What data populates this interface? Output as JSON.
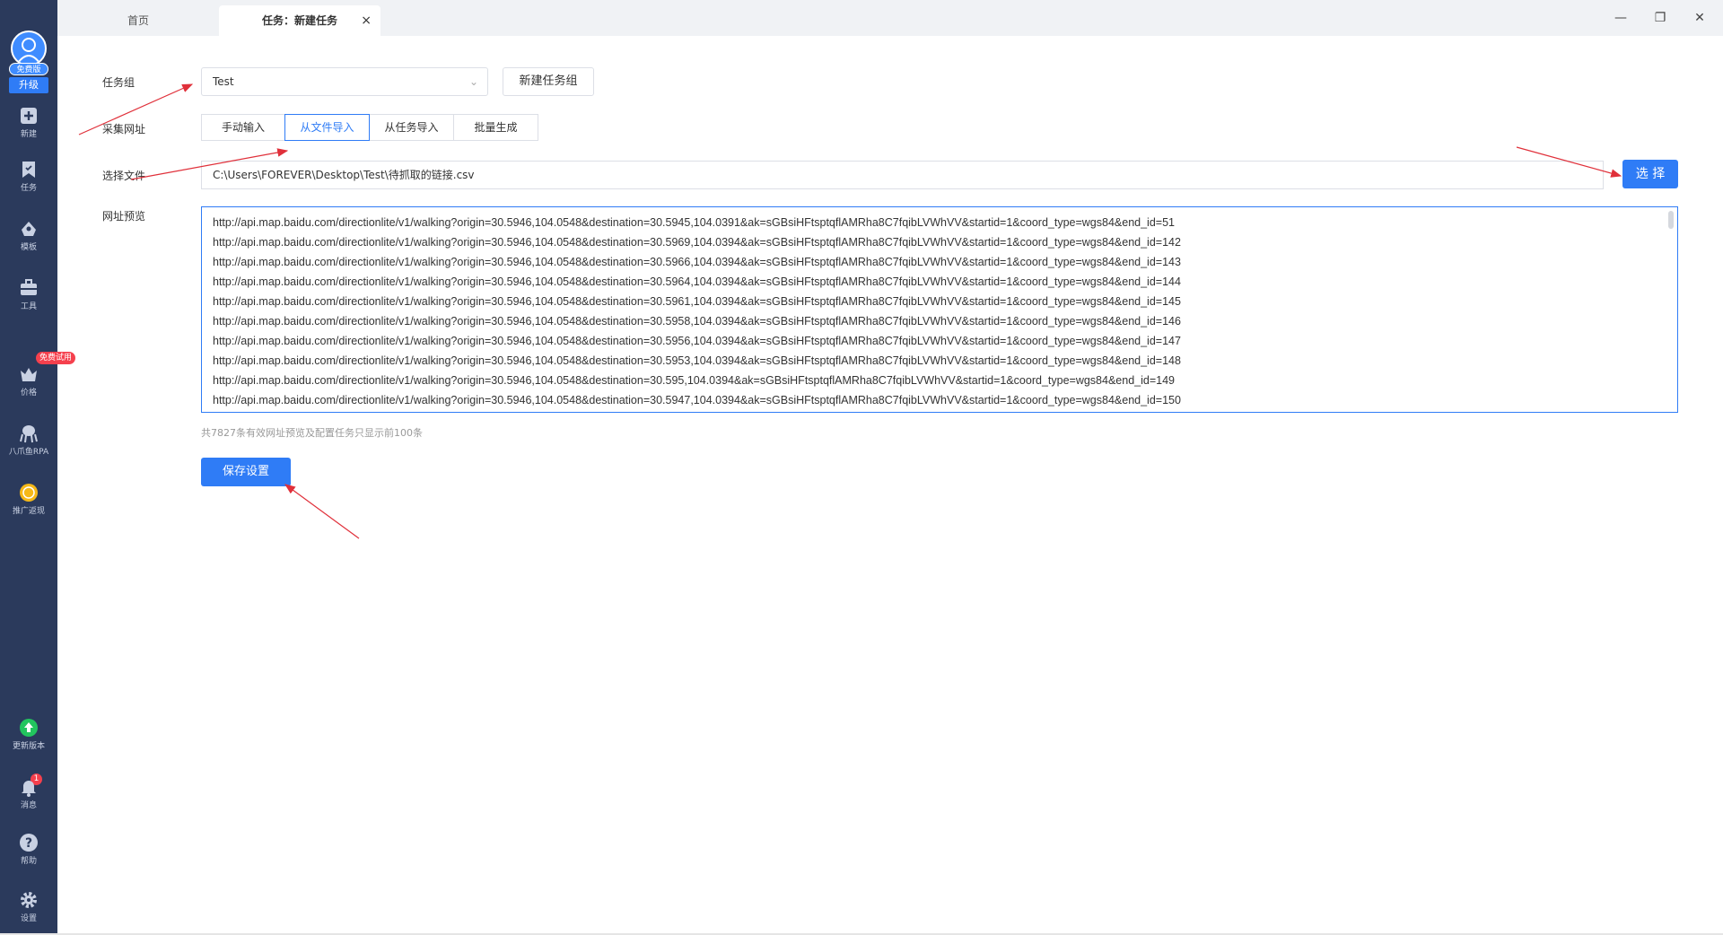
{
  "tabs": {
    "home": "首页",
    "active": "任务：新建任务",
    "close_glyph": "×"
  },
  "window": {
    "minimize": "—",
    "restore": "❐",
    "close": "✕"
  },
  "sidebar": {
    "free_badge": "免费版",
    "upgrade": "升级",
    "items": [
      {
        "label": "新建",
        "icon": "plus-square-icon"
      },
      {
        "label": "任务",
        "icon": "bookmark-icon"
      },
      {
        "label": "模板",
        "icon": "template-icon"
      },
      {
        "label": "工具",
        "icon": "toolbox-icon"
      },
      {
        "label": "价格",
        "icon": "crown-icon"
      },
      {
        "label": "八爪鱼RPA",
        "icon": "octopus-icon"
      },
      {
        "label": "推广返现",
        "icon": "coin-icon"
      },
      {
        "label": "更新版本",
        "icon": "upgrade-icon"
      },
      {
        "label": "消息",
        "icon": "bell-icon"
      },
      {
        "label": "帮助",
        "icon": "help-icon"
      },
      {
        "label": "设置",
        "icon": "gear-icon"
      }
    ],
    "trial_badge": "免费试用",
    "message_count": "1"
  },
  "form": {
    "task_group_label": "任务组",
    "task_group_value": "Test",
    "new_group_button": "新建任务组",
    "url_source_label": "采集网址",
    "url_source_options": [
      "手动输入",
      "从文件导入",
      "从任务导入",
      "批量生成"
    ],
    "url_source_selected": "从文件导入",
    "select_file_label": "选择文件",
    "file_path": "C:\\Users\\FOREVER\\Desktop\\Test\\待抓取的链接.csv",
    "select_button": "选 择",
    "preview_label": "网址预览",
    "preview_lines": [
      "http://api.map.baidu.com/directionlite/v1/walking?origin=30.5946,104.0548&destination=30.5945,104.0391&ak=sGBsiHFtsptqflAMRha8C7fqibLVWhVV&startid=1&coord_type=wgs84&end_id=51",
      "http://api.map.baidu.com/directionlite/v1/walking?origin=30.5946,104.0548&destination=30.5969,104.0394&ak=sGBsiHFtsptqflAMRha8C7fqibLVWhVV&startid=1&coord_type=wgs84&end_id=142",
      "http://api.map.baidu.com/directionlite/v1/walking?origin=30.5946,104.0548&destination=30.5966,104.0394&ak=sGBsiHFtsptqflAMRha8C7fqibLVWhVV&startid=1&coord_type=wgs84&end_id=143",
      "http://api.map.baidu.com/directionlite/v1/walking?origin=30.5946,104.0548&destination=30.5964,104.0394&ak=sGBsiHFtsptqflAMRha8C7fqibLVWhVV&startid=1&coord_type=wgs84&end_id=144",
      "http://api.map.baidu.com/directionlite/v1/walking?origin=30.5946,104.0548&destination=30.5961,104.0394&ak=sGBsiHFtsptqflAMRha8C7fqibLVWhVV&startid=1&coord_type=wgs84&end_id=145",
      "http://api.map.baidu.com/directionlite/v1/walking?origin=30.5946,104.0548&destination=30.5958,104.0394&ak=sGBsiHFtsptqflAMRha8C7fqibLVWhVV&startid=1&coord_type=wgs84&end_id=146",
      "http://api.map.baidu.com/directionlite/v1/walking?origin=30.5946,104.0548&destination=30.5956,104.0394&ak=sGBsiHFtsptqflAMRha8C7fqibLVWhVV&startid=1&coord_type=wgs84&end_id=147",
      "http://api.map.baidu.com/directionlite/v1/walking?origin=30.5946,104.0548&destination=30.5953,104.0394&ak=sGBsiHFtsptqflAMRha8C7fqibLVWhVV&startid=1&coord_type=wgs84&end_id=148",
      "http://api.map.baidu.com/directionlite/v1/walking?origin=30.5946,104.0548&destination=30.595,104.0394&ak=sGBsiHFtsptqflAMRha8C7fqibLVWhVV&startid=1&coord_type=wgs84&end_id=149",
      "http://api.map.baidu.com/directionlite/v1/walking?origin=30.5946,104.0548&destination=30.5947,104.0394&ak=sGBsiHFtsptqflAMRha8C7fqibLVWhVV&startid=1&coord_type=wgs84&end_id=150"
    ],
    "preview_hint": "共7827条有效网址预览及配置任务只显示前100条",
    "save_button": "保存设置"
  },
  "colors": {
    "sidebar_bg": "#2b3a5c",
    "primary": "#2f7cf6",
    "annotation_arrow": "#e0303a"
  }
}
